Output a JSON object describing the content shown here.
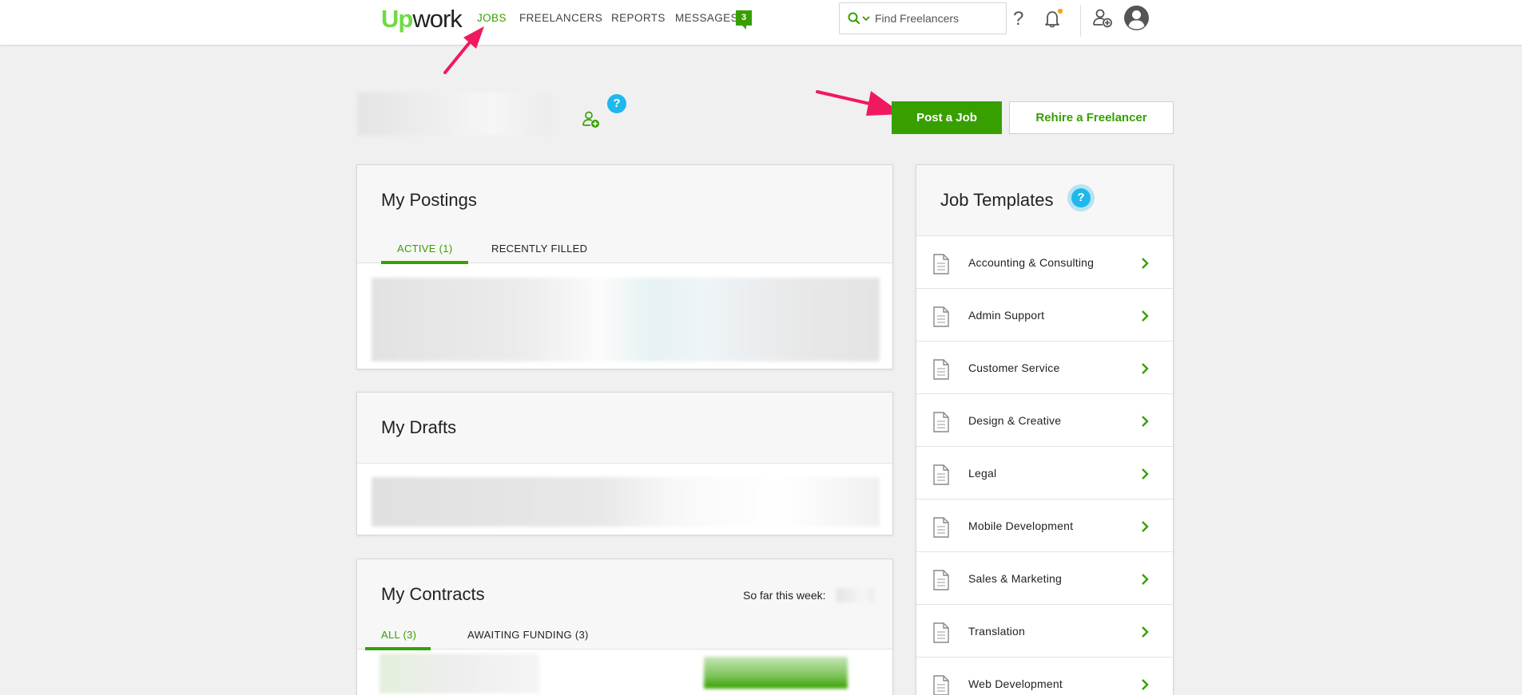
{
  "header": {
    "logo_up": "Up",
    "logo_work": "work",
    "nav": {
      "jobs": "JOBS",
      "freelancers": "FREELANCERS",
      "reports": "REPORTS",
      "messages": "MESSAGES",
      "messages_count": "3"
    },
    "search": {
      "placeholder": "Find Freelancers"
    },
    "icons": [
      "search-icon",
      "chevron-down-icon",
      "help-icon",
      "notification-bell-icon",
      "add-user-icon",
      "account-avatar-icon"
    ],
    "help_glyph": "?"
  },
  "colors": {
    "accent": "#37a000",
    "logo_green": "#6fda44",
    "help_blue": "#1fb8ec",
    "annotation_pink": "#f0195f",
    "notification_dot": "#f5a623"
  },
  "actions": {
    "post_job": "Post a Job",
    "rehire": "Rehire a Freelancer"
  },
  "help_badge": "?",
  "postings": {
    "title": "My Postings",
    "tabs": [
      "ACTIVE (1)",
      "RECENTLY FILLED"
    ]
  },
  "drafts": {
    "title": "My Drafts"
  },
  "contracts": {
    "title": "My Contracts",
    "so_far_label": "So far this week:",
    "tabs": [
      "ALL (3)",
      "AWAITING FUNDING (3)"
    ]
  },
  "templates": {
    "title": "Job Templates",
    "items": [
      {
        "label": "Accounting & Consulting"
      },
      {
        "label": "Admin Support"
      },
      {
        "label": "Customer Service"
      },
      {
        "label": "Design & Creative"
      },
      {
        "label": "Legal"
      },
      {
        "label": "Mobile Development"
      },
      {
        "label": "Sales & Marketing"
      },
      {
        "label": "Translation"
      },
      {
        "label": "Web Development"
      }
    ]
  }
}
